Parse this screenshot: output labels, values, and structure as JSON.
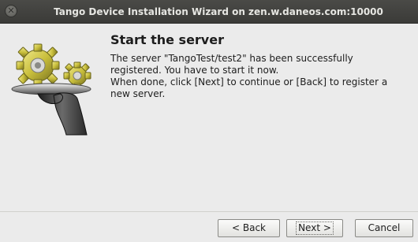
{
  "window": {
    "title": "Tango Device Installation Wizard on zen.w.daneos.com:10000",
    "close_icon": "close-icon"
  },
  "illustration": {
    "icon": "gears-on-tray-illustration"
  },
  "page": {
    "heading": "Start the server",
    "message_lines": [
      "The server \"TangoTest/test2\" has been successfully",
      "registered. You have to start it now.",
      "When done, click [Next] to continue or [Back] to register a",
      "new server."
    ]
  },
  "buttons": {
    "back": "< Back",
    "next": "Next >",
    "cancel": "Cancel"
  },
  "colors": {
    "titlebar": "#3f3f3c",
    "window_bg": "#ebebeb",
    "gear": "#c8c04a",
    "hand": "#3a3a3a"
  }
}
